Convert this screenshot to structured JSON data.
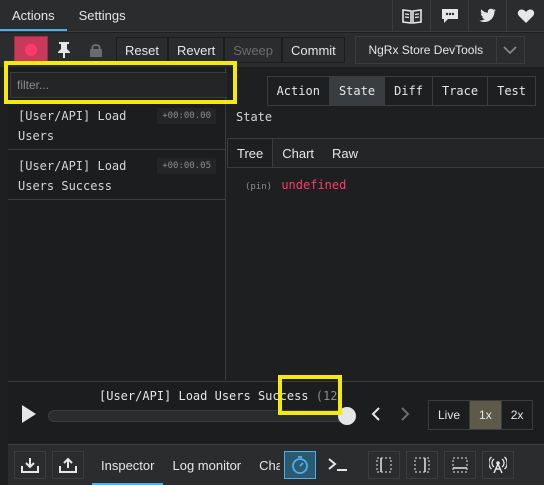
{
  "topbar": {
    "tabs": [
      {
        "label": "Actions",
        "active": true
      },
      {
        "label": "Settings",
        "active": false
      }
    ],
    "icons": [
      "book-icon",
      "chat-icon",
      "twitter-icon",
      "heart-icon"
    ]
  },
  "toolbar": {
    "reset_label": "Reset",
    "revert_label": "Revert",
    "sweep_label": "Sweep",
    "commit_label": "Commit",
    "instance_select": "NgRx Store DevTools"
  },
  "filter": {
    "placeholder": "filter..."
  },
  "actions": [
    {
      "name": "[User/API] Load Users",
      "time": "+00:00.00"
    },
    {
      "name": "[User/API] Load Users Success",
      "time": "+00:00.05"
    }
  ],
  "inspector": {
    "tabs": [
      "Action",
      "State",
      "Diff",
      "Trace",
      "Test"
    ],
    "active_tab": "State",
    "section_label": "State",
    "view_tabs": [
      "Tree",
      "Chart",
      "Raw"
    ],
    "active_view": "Tree",
    "tree_pin": "(pin)",
    "tree_value": "undefined"
  },
  "slider": {
    "current_action": "[User/API] Load Users Success",
    "count": "(12)",
    "position": 1.0,
    "speeds": [
      "Live",
      "1x",
      "2x"
    ],
    "active_speed": "1x"
  },
  "bottombar": {
    "tabs": [
      "Inspector",
      "Log monitor",
      "Cha"
    ],
    "active_tab": "Inspector"
  },
  "colors": {
    "accent": "#4ab0f0",
    "record": "#c73a5c",
    "highlight": "#f5ea0c",
    "undefined_value": "#ff3a6a"
  }
}
